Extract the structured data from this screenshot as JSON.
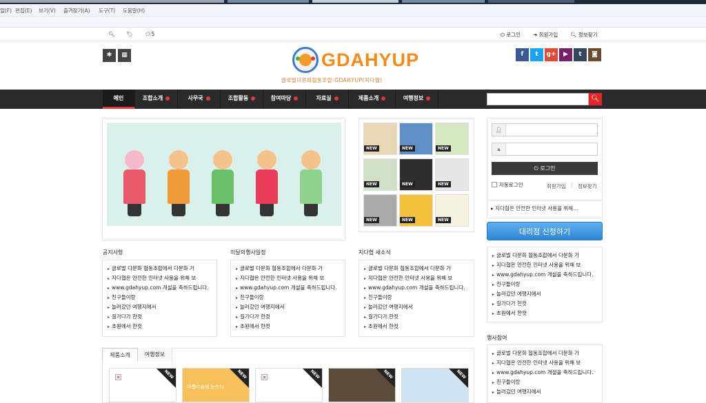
{
  "browser": {
    "menu": [
      "일(F)",
      "편집(E)",
      "보기(V)",
      "즐겨찾기(A)",
      "도구(T)",
      "도움말(H)"
    ]
  },
  "topbar": {
    "comment_count": "5",
    "login": "로그인",
    "signup": "회원가입",
    "info": "정보찾기"
  },
  "header": {
    "logo_text": "GDAHYUP",
    "tagline": "글로벌다문화협동조합-GDAHYUP(지다협)"
  },
  "social": [
    {
      "icon": "facebook-icon",
      "glyph": "f",
      "color": "#3b5998"
    },
    {
      "icon": "twitter-icon",
      "glyph": "t",
      "color": "#1da1f2"
    },
    {
      "icon": "google-plus-icon",
      "glyph": "g+",
      "color": "#dd4b39"
    },
    {
      "icon": "youtube-icon",
      "glyph": "▶",
      "color": "#7b1f6a"
    },
    {
      "icon": "tumblr-icon",
      "glyph": "t",
      "color": "#35465c"
    },
    {
      "icon": "instagram-icon",
      "glyph": "◙",
      "color": "#6b4a2f"
    }
  ],
  "nav": {
    "items": [
      "메인",
      "조합소개",
      "사무국",
      "조합활동",
      "참여마당",
      "자료실",
      "제품소개",
      "여행정보"
    ]
  },
  "sections": {
    "notice": "공지사항",
    "schedule": "이달의행사일정",
    "news": "지다협 새소식",
    "participation": "행사참여"
  },
  "lists": {
    "notice": [
      "글로벌 다문화 협동조합에서 다문화 가",
      "지다협은 안전한 인터넷 사용을 위해 보",
      "www.gdahyup.com 개설을 축하드립니다.",
      "친구들이랑",
      "놀러갔던 여행지에서",
      "길가다가 한컷",
      "초원에서 한컷"
    ],
    "schedule": [
      "글로벌 다문화 협동조합에서 다문화 가",
      "지다협은 안전한 인터넷 사용을 위해 보",
      "www.gdahyup.com 개설을 축하드립니다.",
      "친구들이랑",
      "놀러갔던 여행지에서",
      "길가다가 한컷",
      "초원에서 한컷"
    ],
    "news": [
      "글로벌 다문화 협동조합에서 다문화 가",
      "지다협은 안전한 인터넷 사용을 위해 보",
      "www.gdahyup.com 개설을 축하드립니다.",
      "친구들이랑",
      "놀러갔던 여행지에서",
      "길가다가 한컷",
      "초원에서 한컷"
    ],
    "sidebar": [
      "글로벌 다문화 협동조합에서 다문화 가",
      "지다협은 안전한 인터넷 사용을 위해 보",
      "www.gdahyup.com 개설을 축하드립니다.",
      "친구들이랑",
      "놀러갔던 여행지에서",
      "길가다가 한컷",
      "초원에서 한컷"
    ],
    "participation": [
      "글로벌 다문화 협동조합에서 다문화 가",
      "지다협은 안전한 인터넷 사용을 위해 보",
      "www.gdahyup.com 개설을 축하드립니다.",
      "친구들이랑",
      "놀러갔던 여행지에서"
    ]
  },
  "thumbs": {
    "new_label": "NEW",
    "colors": [
      "#e9d6b5",
      "#5f8fc4",
      "#d6e8c1",
      "#cfe0c7",
      "#2e2e2e",
      "#e6e6e6",
      "#aaaaaa",
      "#f3c23d",
      "#f7f1e0"
    ]
  },
  "login": {
    "button": "로그인",
    "auto_login": "자동로그인",
    "signup": "회원가입",
    "find": "정보찾기",
    "notice": "지다협은 안전한 인터넷 사용을 위해..."
  },
  "agency_button": "대리점 신청하기",
  "product_tabs": [
    "제품소개",
    "여행정보"
  ],
  "products": {
    "new_label": "NEW",
    "overlay_text": "아름다움에 눈뜨다"
  }
}
